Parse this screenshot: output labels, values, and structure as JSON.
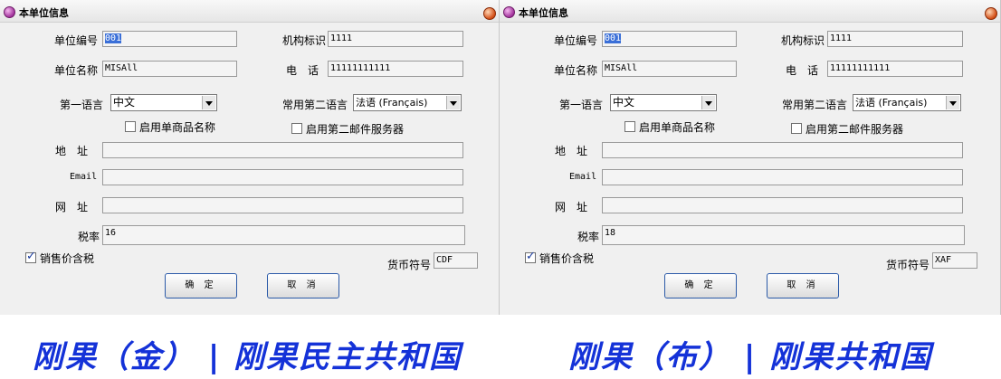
{
  "left": {
    "window_title": "本单位信息",
    "labels": {
      "unit_no": "单位编号",
      "org_id": "机构标识",
      "unit_name": "单位名称",
      "phone": "电　话",
      "first_lang": "第一语言",
      "second_lang": "常用第二语言",
      "single_name": "启用单商品名称",
      "second_mail": "启用第二邮件服务器",
      "address": "地　址",
      "email": "Email",
      "website": "网　址",
      "tax_rate": "税率",
      "tax_included": "销售价含税",
      "currency": "货币符号"
    },
    "values": {
      "unit_no": "001",
      "org_id": "1111",
      "unit_name": "MISAll",
      "phone": "11111111111",
      "first_lang": "中文",
      "second_lang": "法语 (Français)",
      "address": "",
      "email": "",
      "website": "",
      "tax_rate": "16",
      "currency": "CDF"
    },
    "checks": {
      "single_name": false,
      "second_mail": false,
      "tax_included": true
    },
    "buttons": {
      "ok": "确 定",
      "cancel": "取 消"
    }
  },
  "right": {
    "window_title": "本单位信息",
    "labels": {
      "unit_no": "单位编号",
      "org_id": "机构标识",
      "unit_name": "单位名称",
      "phone": "电　话",
      "first_lang": "第一语言",
      "second_lang": "常用第二语言",
      "single_name": "启用单商品名称",
      "second_mail": "启用第二邮件服务器",
      "address": "地　址",
      "email": "Email",
      "website": "网　址",
      "tax_rate": "税率",
      "tax_included": "销售价含税",
      "currency": "货币符号"
    },
    "values": {
      "unit_no": "001",
      "org_id": "1111",
      "unit_name": "MISAll",
      "phone": "11111111111",
      "first_lang": "中文",
      "second_lang": "法语 (Français)",
      "address": "",
      "email": "",
      "website": "",
      "tax_rate": "18",
      "currency": "XAF"
    },
    "checks": {
      "single_name": false,
      "second_mail": false,
      "tax_included": true
    },
    "buttons": {
      "ok": "确 定",
      "cancel": "取 消"
    }
  },
  "captions": {
    "left": "刚果（金） | 刚果民主共和国",
    "right": "刚果（布） | 刚果共和国"
  }
}
